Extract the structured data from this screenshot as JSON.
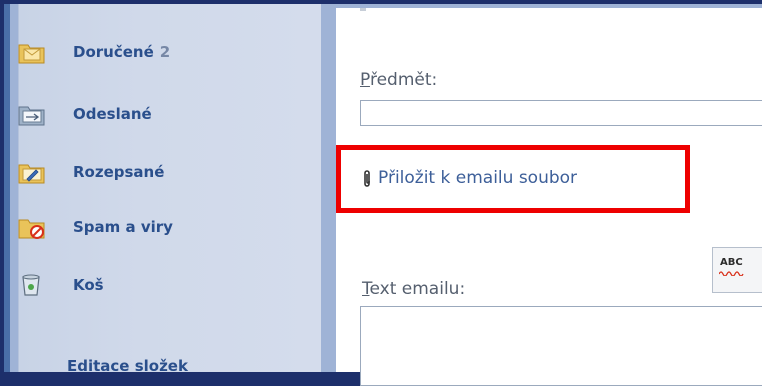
{
  "sidebar": {
    "folders": [
      {
        "label": "Doručené",
        "count": "2",
        "icon": "inbox-folder-icon"
      },
      {
        "label": "Odeslané",
        "icon": "sent-folder-icon"
      },
      {
        "label": "Rozepsané",
        "icon": "drafts-folder-icon"
      },
      {
        "label": "Spam a viry",
        "icon": "spam-folder-icon"
      },
      {
        "label": "Koš",
        "icon": "trash-icon"
      }
    ],
    "edit_folders": "Editace složek"
  },
  "compose": {
    "subject_label_access": "P",
    "subject_label_rest": "ředmět:",
    "subject_value": "",
    "attach_link": "Přiložit k emailu soubor",
    "attach_icon": "paperclip-icon",
    "text_label_access": "T",
    "text_label_rest": "ext emailu:",
    "body_value": "",
    "spellcheck_label": "ABC",
    "spellcheck_icon": "spellcheck-icon"
  },
  "colors": {
    "highlight": "#ee0000",
    "link": "#3d5f99",
    "sidebar_text": "#2a4f8c"
  }
}
